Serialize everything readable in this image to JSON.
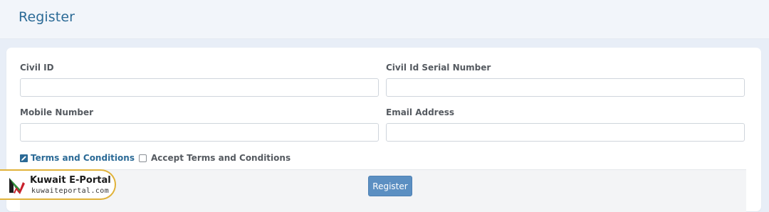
{
  "header": {
    "title": "Register"
  },
  "form": {
    "civil_id": {
      "label": "Civil ID",
      "value": "",
      "placeholder": ""
    },
    "civil_id_serial": {
      "label": "Civil Id Serial Number",
      "value": "",
      "placeholder": ""
    },
    "mobile_number": {
      "label": "Mobile Number",
      "value": "",
      "placeholder": ""
    },
    "email_address": {
      "label": "Email Address",
      "value": "",
      "placeholder": ""
    },
    "terms_link": "Terms and Conditions",
    "accept_terms_label": "Accept Terms and Conditions",
    "accept_terms_checked": false,
    "register_button": "Register"
  },
  "watermark": {
    "name": "Kuwait E-Portal",
    "url": "kuwaiteportal.com"
  },
  "colors": {
    "accent": "#2b6a96",
    "button": "#5b8fc2",
    "watermark_border": "#e0b23a"
  },
  "icons": {
    "terms": "edit-icon",
    "checkbox": "checkbox-icon",
    "logo": "kuwait-eportal-logo"
  }
}
